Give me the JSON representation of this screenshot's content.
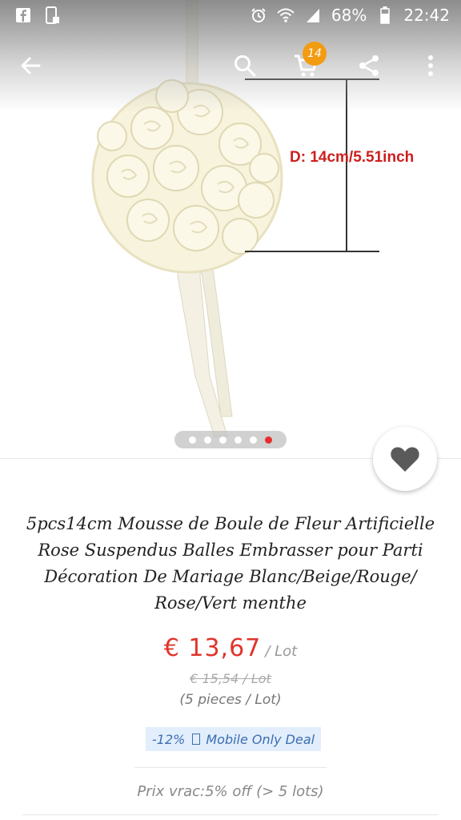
{
  "status_bar": {
    "battery_percent": "68%",
    "time": "22:42",
    "icons": [
      "facebook-icon",
      "screenshot-icon",
      "alarm-icon",
      "wifi-icon",
      "signal-icon",
      "battery-icon"
    ]
  },
  "app_bar": {
    "cart_count": "14",
    "icons": [
      "back-arrow-icon",
      "search-icon",
      "cart-icon",
      "share-icon",
      "more-vert-icon"
    ]
  },
  "gallery": {
    "dimension_label": "D: 14cm/5.51inch",
    "total_images": 6,
    "active_index": 5
  },
  "product": {
    "title": "5pcs14cm Mousse de Boule de Fleur Artificielle Rose Suspendus Balles Embrasser pour Parti Décoration De Mariage Blanc/Beige/Rouge/ Rose/Vert menthe",
    "price": "€ 13,67",
    "price_unit": "/ Lot",
    "original_price": "€ 15,54 / Lot",
    "pieces": "(5 pieces / Lot)",
    "deal_percent": "-12%",
    "deal_text": "Mobile Only Deal",
    "bulk_price": "Prix vrac:5% off (> 5 lots)"
  },
  "colors": {
    "price": "#e0352b",
    "deal_bg": "#e2eefb",
    "deal_text": "#3b6db3",
    "badge": "#f39c12",
    "pager_active": "#e62e2e"
  }
}
